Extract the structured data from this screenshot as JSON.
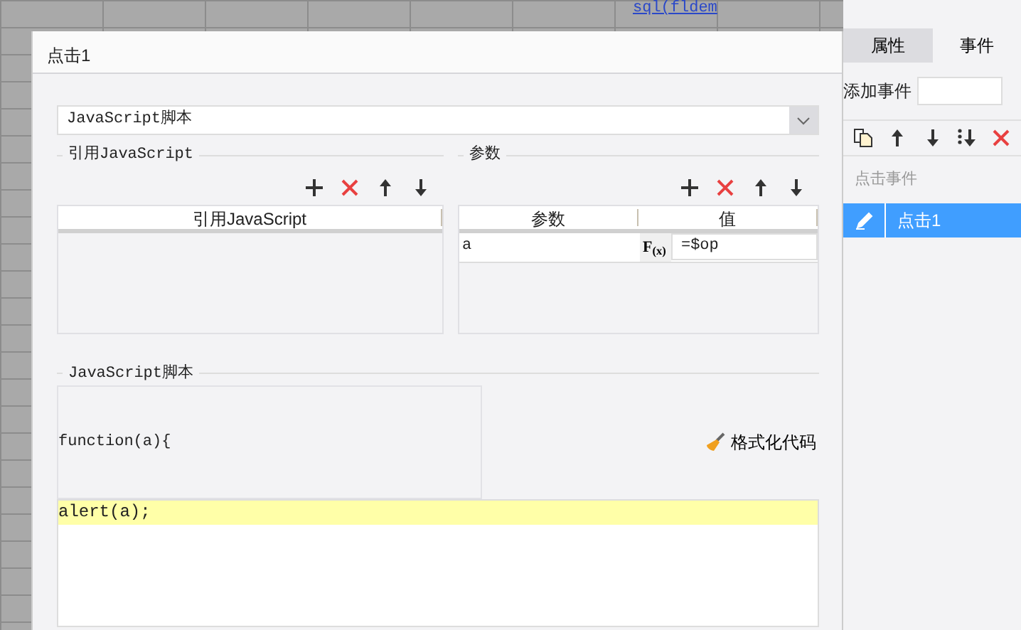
{
  "background": {
    "cell_text": "sql(fldem"
  },
  "dialog": {
    "title": "点击1",
    "script_type": "JavaScript脚本",
    "references": {
      "title": "引用JavaScript",
      "columns": [
        "引用JavaScript"
      ]
    },
    "params": {
      "title": "参数",
      "columns": [
        "参数",
        "值"
      ],
      "rows": [
        {
          "name": "a",
          "formula": "F$_{(x)}$",
          "value": "=$op"
        }
      ]
    },
    "script": {
      "title": "JavaScript脚本",
      "header": "function(a){",
      "format_button": "格式化代码",
      "lines": [
        {
          "text": "alert(a);",
          "highlighted": true
        }
      ]
    }
  },
  "panel": {
    "tabs": [
      {
        "label": "属性",
        "selected": false
      },
      {
        "label": "事件",
        "selected": true
      }
    ],
    "add_event_label": "添加事件",
    "group": "点击事件",
    "events": [
      {
        "label": "点击1",
        "selected": true
      }
    ]
  }
}
